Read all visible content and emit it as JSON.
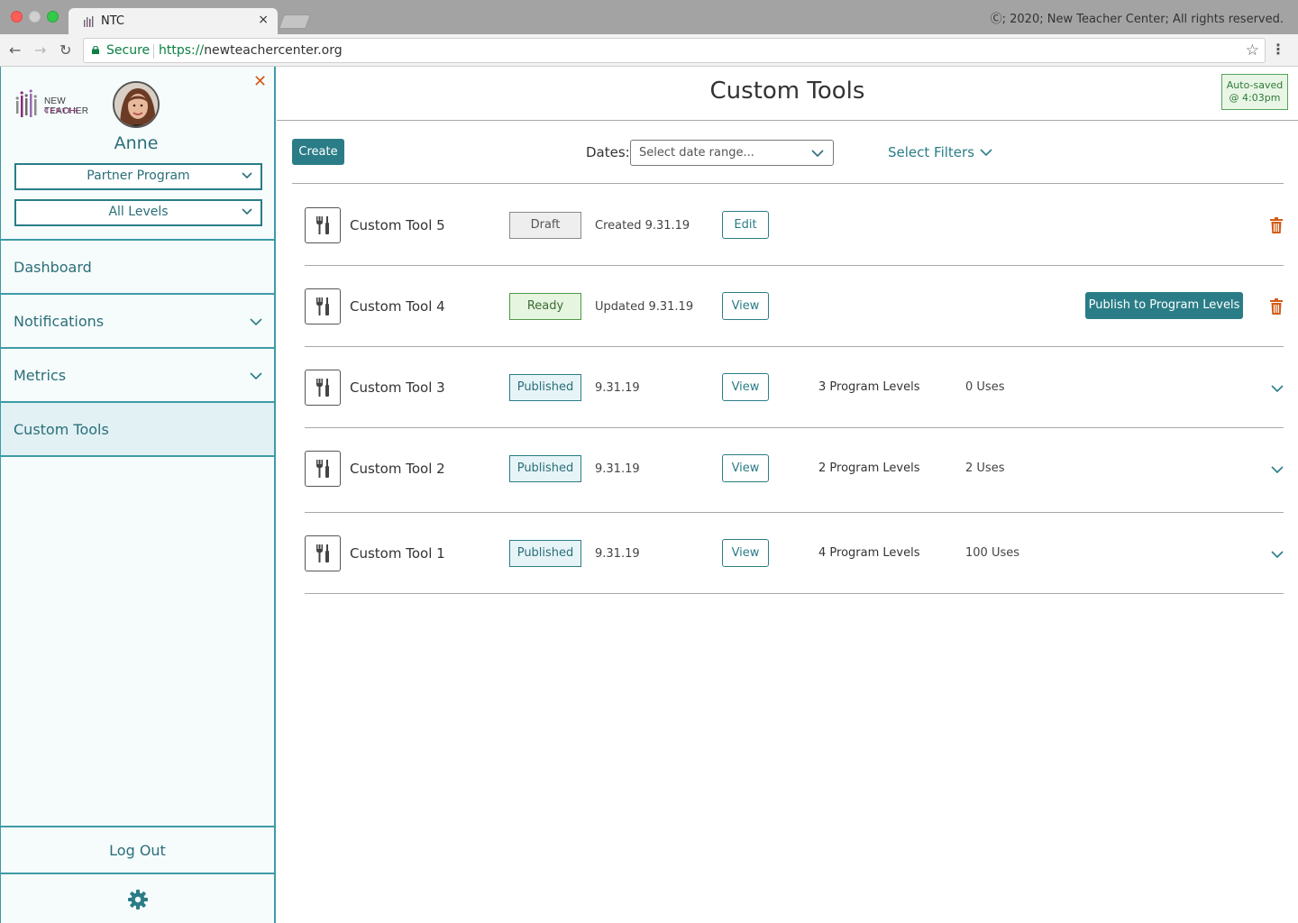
{
  "browser": {
    "tab_title": "NTC",
    "copyright": "Ⓒ; 2020; New Teacher Center; All rights reserved.",
    "secure_label": "Secure",
    "url_scheme": "https://",
    "url_host": "newteachercenter.org"
  },
  "sidebar": {
    "logo_line1": "NEW TEACHER",
    "logo_line2": "CENTER",
    "user_name": "Anne",
    "program_select": "Partner Program",
    "level_select": "All Levels",
    "nav": [
      {
        "label": "Dashboard",
        "has_chevron": false,
        "active": false
      },
      {
        "label": "Notifications",
        "has_chevron": true,
        "active": false
      },
      {
        "label": "Metrics",
        "has_chevron": true,
        "active": false
      },
      {
        "label": "Custom Tools",
        "has_chevron": false,
        "active": true
      }
    ],
    "logout": "Log Out",
    "settings_icon": "gear-icon"
  },
  "header": {
    "title": "Custom Tools",
    "autosave_line1": "Auto-saved",
    "autosave_line2": "@ 4:03pm"
  },
  "controls": {
    "create": "Create",
    "dates_label": "Dates:",
    "date_placeholder": "Select date range...",
    "filters": "Select Filters"
  },
  "tools": [
    {
      "name": "Custom Tool 5",
      "status": "Draft",
      "date": "Created 9.31.19",
      "action": "Edit"
    },
    {
      "name": "Custom Tool 4",
      "status": "Ready",
      "date": "Updated 9.31.19",
      "action": "View",
      "publish": "Publish to Program Levels"
    },
    {
      "name": "Custom Tool 3",
      "status": "Published",
      "date": "9.31.19",
      "action": "View",
      "levels": "3 Program Levels",
      "uses": "0 Uses"
    },
    {
      "name": "Custom Tool 2",
      "status": "Published",
      "date": "9.31.19",
      "action": "View",
      "levels": "2 Program Levels",
      "uses": "2 Uses"
    },
    {
      "name": "Custom Tool 1",
      "status": "Published",
      "date": "9.31.19",
      "action": "View",
      "levels": "4 Program Levels",
      "uses": "100 Uses"
    }
  ],
  "colors": {
    "accent": "#2a7d87",
    "danger": "#d35d1a",
    "sidebar_bg": "#f6fbfc"
  }
}
